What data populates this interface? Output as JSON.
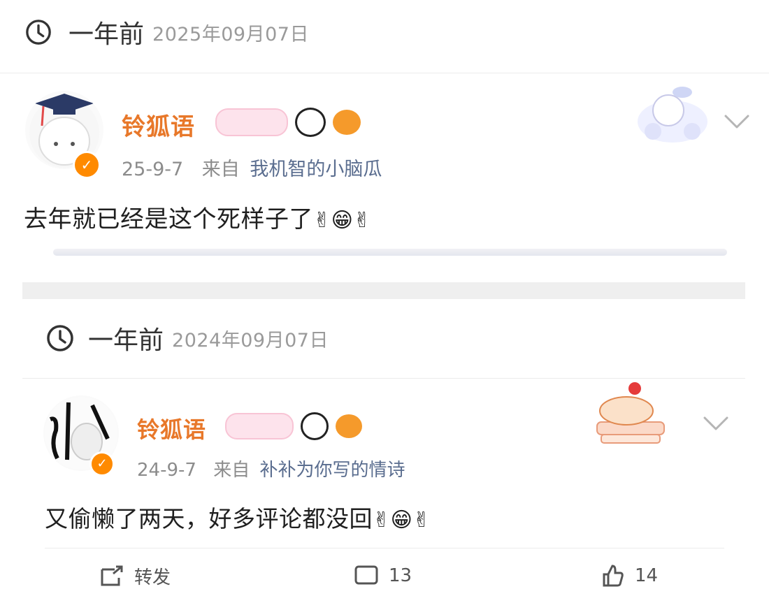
{
  "post1": {
    "time_ago": "一年前",
    "date": "2025年09月07日",
    "user_name": "铃狐语",
    "time": "25-9-7",
    "from_label": "来自",
    "source": "我机智的小脑瓜",
    "text": "去年就已经是这个死样子了",
    "trailing_emojis": [
      "✌",
      "😁",
      "✌"
    ]
  },
  "post2": {
    "time_ago": "一年前",
    "date": "2024年09月07日",
    "user_name": "铃狐语",
    "time": "24-9-7",
    "from_label": "来自",
    "source": "补补为你写的情诗",
    "text": "又偷懒了两天，好多评论都没回",
    "trailing_emojis": [
      "✌",
      "😁",
      "✌"
    ]
  },
  "actions": {
    "repost_label": "转发",
    "comment_count": "13",
    "like_count": "14"
  },
  "colors": {
    "name_orange": "#e8782a",
    "source_blue": "#5a6d8f",
    "meta_gray": "#8c8c8c",
    "badge_orange": "#ff8a00"
  }
}
